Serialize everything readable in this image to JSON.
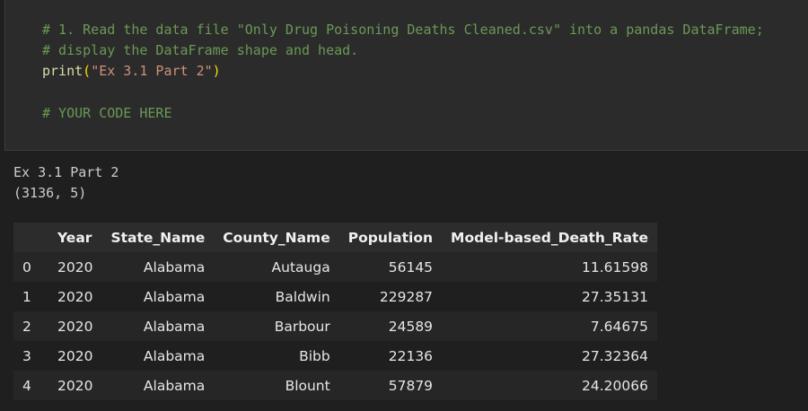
{
  "code_cell": {
    "lines": [
      {
        "parts": [
          {
            "cls": "tok-comment",
            "text": "# 1. Read the data file \"Only Drug Poisoning Deaths Cleaned.csv\" into a pandas DataFrame;"
          }
        ]
      },
      {
        "parts": [
          {
            "cls": "tok-comment",
            "text": "# display the DataFrame shape and head."
          }
        ]
      },
      {
        "parts": [
          {
            "cls": "tok-func",
            "text": "print"
          },
          {
            "cls": "tok-paren",
            "text": "("
          },
          {
            "cls": "tok-string",
            "text": "\"Ex 3.1 Part 2\""
          },
          {
            "cls": "tok-paren",
            "text": ")"
          }
        ]
      },
      {
        "parts": []
      },
      {
        "parts": [
          {
            "cls": "tok-comment",
            "text": "# YOUR CODE HERE"
          }
        ]
      }
    ]
  },
  "output": {
    "stdout_lines": [
      "Ex 3.1 Part 2",
      "(3136, 5)"
    ],
    "table": {
      "columns": [
        "",
        "Year",
        "State_Name",
        "County_Name",
        "Population",
        "Model-based_Death_Rate"
      ],
      "rows": [
        {
          "index": "0",
          "cells": [
            "2020",
            "Alabama",
            "Autauga",
            "56145",
            "11.61598"
          ]
        },
        {
          "index": "1",
          "cells": [
            "2020",
            "Alabama",
            "Baldwin",
            "229287",
            "27.35131"
          ]
        },
        {
          "index": "2",
          "cells": [
            "2020",
            "Alabama",
            "Barbour",
            "24589",
            "7.64675"
          ]
        },
        {
          "index": "3",
          "cells": [
            "2020",
            "Alabama",
            "Bibb",
            "22136",
            "27.32364"
          ]
        },
        {
          "index": "4",
          "cells": [
            "2020",
            "Alabama",
            "Blount",
            "57879",
            "24.20066"
          ]
        }
      ]
    }
  }
}
